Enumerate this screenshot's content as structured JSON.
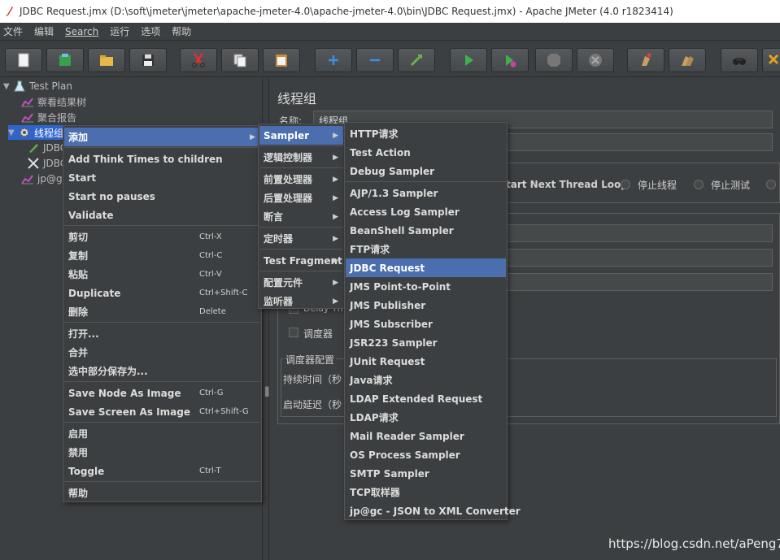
{
  "window": {
    "title": "JDBC Request.jmx (D:\\soft\\jmeter\\jmeter\\apache-jmeter-4.0\\apache-jmeter-4.0\\bin\\JDBC Request.jmx) - Apache JMeter (4.0 r1823414)"
  },
  "menubar": [
    "文件",
    "编辑",
    "Search",
    "运行",
    "选项",
    "帮助"
  ],
  "toolbar": [
    "new-icon",
    "templates-icon",
    "open-icon",
    "save-icon",
    "cut-icon",
    "copy-icon",
    "paste-icon",
    "expand-icon",
    "collapse-icon",
    "toggle-icon",
    "start-icon",
    "start-no-pause-icon",
    "stop-icon",
    "shutdown-icon",
    "clear-icon",
    "clear-all-icon",
    "search-icon",
    "reset-icon"
  ],
  "tree": {
    "root": "Test Plan",
    "items": [
      "察看结果树",
      "聚合报告",
      "线程组",
      "JDBC",
      "JDBC",
      "jp@gc"
    ]
  },
  "editor": {
    "title": "线程组",
    "name_label": "名称:",
    "name_value": "线程组",
    "on_error_text": "tart Next Thread Loop",
    "stop_thread": "停止线程",
    "stop_test": "停止测试",
    "delay_label": "Delay Th",
    "scheduler_label": "调度器",
    "scheduler_config": "调度器配置",
    "duration_label": "持续时间（秒",
    "startup_delay_label": "启动延迟（秒"
  },
  "context_menu": {
    "groups": [
      [
        {
          "label": "添加",
          "submenu": true,
          "highlight": true
        }
      ],
      [
        {
          "label": "Add Think Times to children"
        },
        {
          "label": "Start"
        },
        {
          "label": "Start no pauses"
        },
        {
          "label": "Validate"
        }
      ],
      [
        {
          "label": "剪切",
          "shortcut": "Ctrl-X"
        },
        {
          "label": "复制",
          "shortcut": "Ctrl-C"
        },
        {
          "label": "粘贴",
          "shortcut": "Ctrl-V"
        },
        {
          "label": "Duplicate",
          "shortcut": "Ctrl+Shift-C"
        },
        {
          "label": "删除",
          "shortcut": "Delete"
        }
      ],
      [
        {
          "label": "打开..."
        },
        {
          "label": "合并"
        },
        {
          "label": "选中部分保存为..."
        }
      ],
      [
        {
          "label": "Save Node As Image",
          "shortcut": "Ctrl-G"
        },
        {
          "label": "Save Screen As Image",
          "shortcut": "Ctrl+Shift-G"
        }
      ],
      [
        {
          "label": "启用"
        },
        {
          "label": "禁用"
        },
        {
          "label": "Toggle",
          "shortcut": "Ctrl-T"
        }
      ],
      [
        {
          "label": "帮助"
        }
      ]
    ]
  },
  "add_menu": {
    "groups": [
      [
        {
          "label": "Sampler",
          "submenu": true,
          "highlight": true
        }
      ],
      [
        {
          "label": "逻辑控制器",
          "submenu": true
        }
      ],
      [
        {
          "label": "前置处理器",
          "submenu": true
        },
        {
          "label": "后置处理器",
          "submenu": true
        },
        {
          "label": "断言",
          "submenu": true
        }
      ],
      [
        {
          "label": "定时器",
          "submenu": true
        }
      ],
      [
        {
          "label": "Test Fragment",
          "submenu": true
        }
      ],
      [
        {
          "label": "配置元件",
          "submenu": true
        },
        {
          "label": "监听器",
          "submenu": true
        }
      ]
    ]
  },
  "sampler_menu": {
    "groups": [
      [
        {
          "label": "HTTP请求"
        },
        {
          "label": "Test Action"
        },
        {
          "label": "Debug Sampler"
        }
      ],
      [
        {
          "label": "AJP/1.3 Sampler"
        },
        {
          "label": "Access Log Sampler"
        },
        {
          "label": "BeanShell Sampler"
        },
        {
          "label": "FTP请求"
        },
        {
          "label": "JDBC Request",
          "highlight": true
        },
        {
          "label": "JMS Point-to-Point"
        },
        {
          "label": "JMS Publisher"
        },
        {
          "label": "JMS Subscriber"
        },
        {
          "label": "JSR223 Sampler"
        },
        {
          "label": "JUnit Request"
        },
        {
          "label": "Java请求"
        },
        {
          "label": "LDAP Extended Request"
        },
        {
          "label": "LDAP请求"
        },
        {
          "label": "Mail Reader Sampler"
        },
        {
          "label": "OS Process Sampler"
        },
        {
          "label": "SMTP Sampler"
        },
        {
          "label": "TCP取样器"
        },
        {
          "label": "jp@gc - JSON to XML Converter"
        }
      ]
    ]
  },
  "watermark": "https://blog.csdn.net/aPeng7"
}
